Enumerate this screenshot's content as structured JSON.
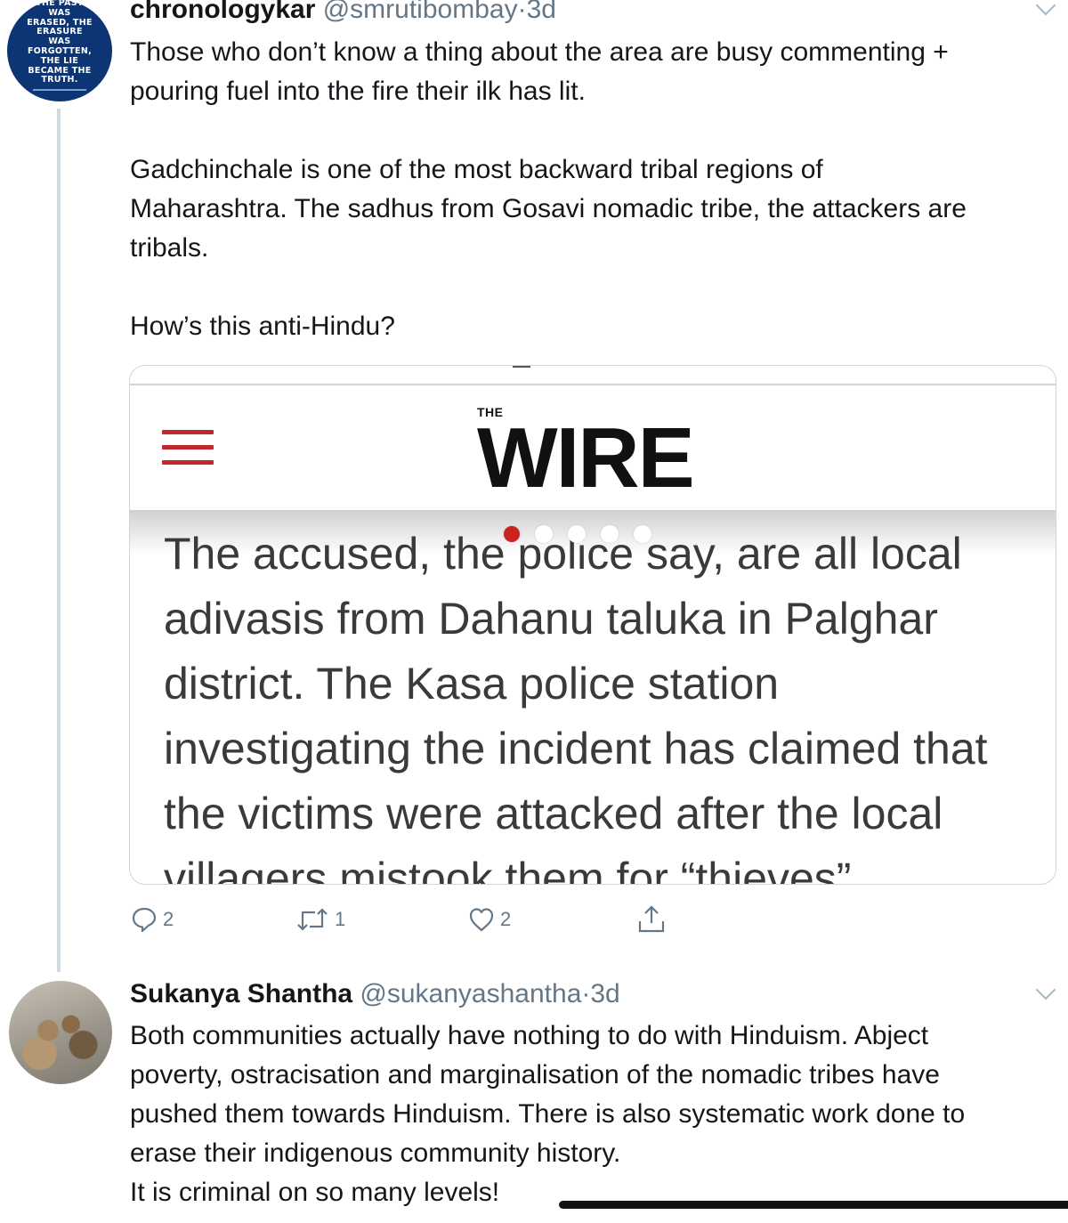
{
  "tweet1": {
    "avatar_text": "THE PAST\nWAS\nERASED, THE\nERASURE\nWAS\nFORGOTTEN,\nTHE LIE\nBECAME THE\nTRUTH.",
    "name": "chronologykar",
    "handle": "@smrutibombay",
    "separator": "·",
    "time": "3d",
    "lines": [
      "Those who don’t know a thing about the area are busy commenting +",
      "pouring fuel into the fire their ilk has lit.",
      "",
      "Gadchinchale is one of the most backward tribal regions of",
      "Maharashtra. The  sadhus from Gosavi nomadic tribe, the attackers are",
      "tribals.",
      "",
      "How’s this anti-Hindu?"
    ],
    "card": {
      "logo_small": "THE",
      "logo_big": "WIRE",
      "article_lines": [
        "The accused, the police say, are all local",
        "adivasis from Dahanu taluka in Palghar",
        "district.  The Kasa police station",
        "investigating the incident has claimed that",
        "the victims were attacked after the local",
        "villagers mistook them for “thieves”"
      ]
    },
    "actions": {
      "replies": "2",
      "retweets": "1",
      "likes": "2"
    }
  },
  "tweet2": {
    "name": "Sukanya Shantha",
    "handle": "@sukanyashantha",
    "separator": "·",
    "time": "3d",
    "lines": [
      "Both communities actually have nothing to do with Hinduism. Abject",
      "poverty, ostracisation and marginalisation of the nomadic tribes have",
      "pushed them towards Hinduism. There is also systematic work done to",
      "erase their indigenous community history.",
      "It is criminal on so many levels!"
    ]
  },
  "colors": {
    "secondary_text": "#657786",
    "wire_red": "#c0282d",
    "thread_line": "#cfd9de"
  },
  "icons": [
    "reply-icon",
    "retweet-icon",
    "like-icon",
    "share-icon",
    "chevron-down-icon",
    "menu-icon"
  ]
}
